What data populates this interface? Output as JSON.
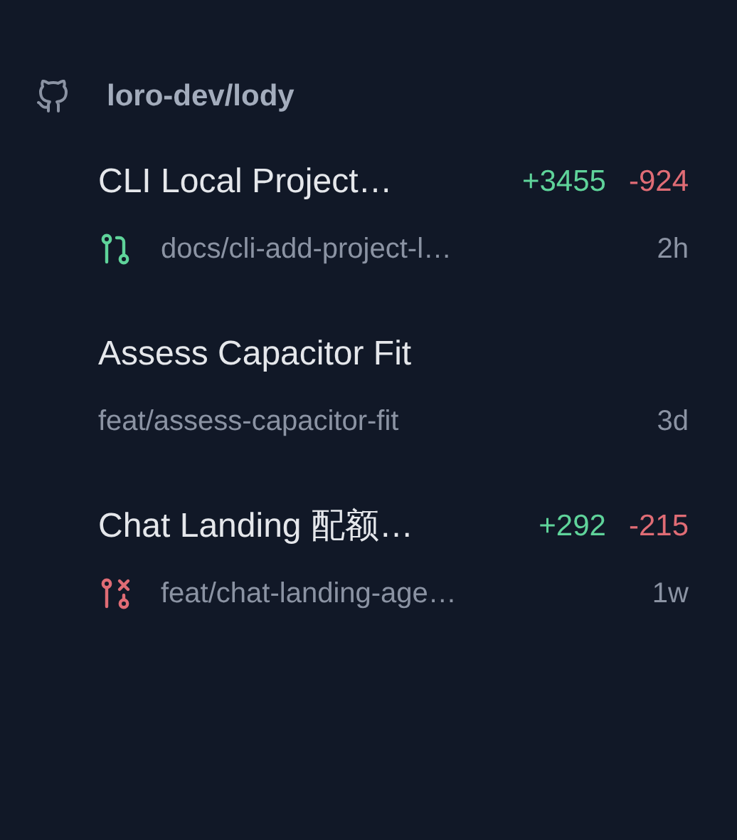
{
  "repo": {
    "name": "loro-dev/lody"
  },
  "items": [
    {
      "title": "CLI Local Project…",
      "additions": "+3455",
      "deletions": "-924",
      "kind": "open",
      "branch": "docs/cli-add-project-l…",
      "age": "2h"
    },
    {
      "title": "Assess Capacitor Fit",
      "kind": "none",
      "branch": "feat/assess-capacitor-fit",
      "age": "3d"
    },
    {
      "title": "Chat Landing 配额…",
      "additions": "+292",
      "deletions": "-215",
      "kind": "closed",
      "branch": "feat/chat-landing-age…",
      "age": "1w"
    }
  ]
}
